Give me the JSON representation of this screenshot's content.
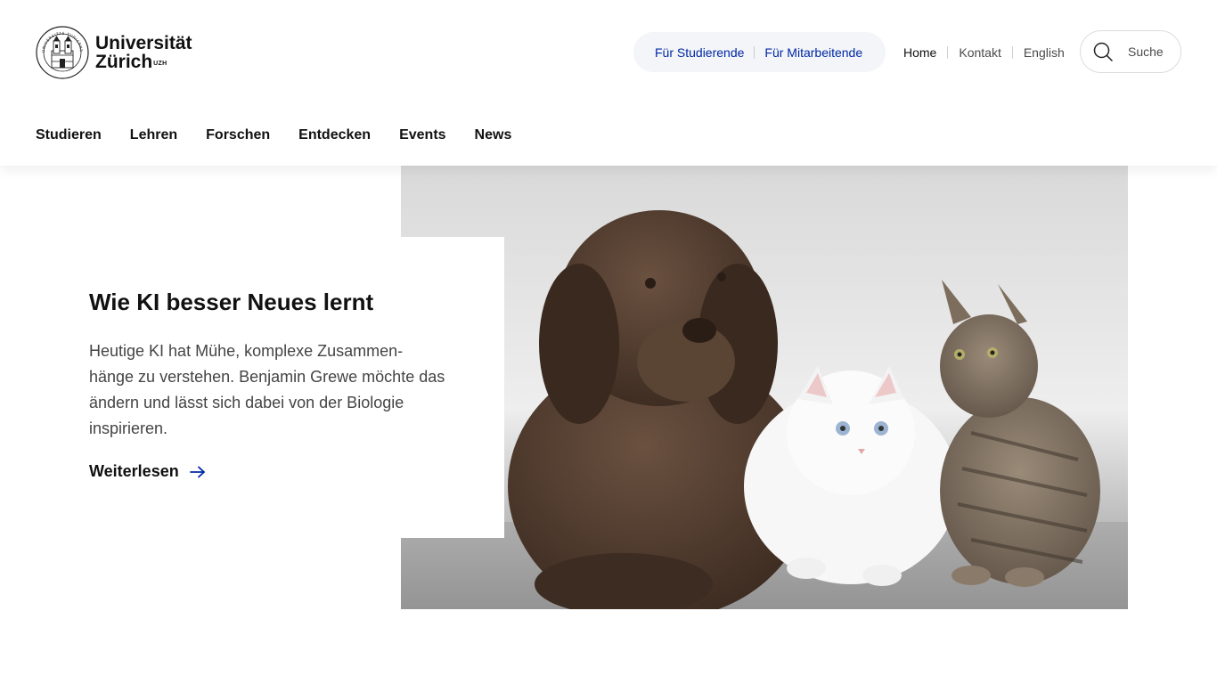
{
  "brand": {
    "line1": "Universität",
    "line2": "Zürich",
    "superscript": "UZH",
    "seal_text": "UNIVERSITAS TURICENSIS MDCCCXXXIII"
  },
  "target_nav": [
    {
      "label": "Für Studierende"
    },
    {
      "label": "Für Mitarbeitende"
    }
  ],
  "meta_nav": [
    {
      "label": "Home",
      "active": true
    },
    {
      "label": "Kontakt",
      "active": false
    },
    {
      "label": "English",
      "active": false
    }
  ],
  "search": {
    "label": "Suche",
    "icon": "search-icon"
  },
  "main_nav": [
    {
      "label": "Studieren"
    },
    {
      "label": "Lehren"
    },
    {
      "label": "Forschen"
    },
    {
      "label": "Entdecken"
    },
    {
      "label": "Events"
    },
    {
      "label": "News"
    }
  ],
  "hero": {
    "title": "Wie KI besser Neues lernt",
    "text": "Heutige KI hat Mühe, komplexe Zusammen-hänge zu verstehen. Benjamin Grewe möchte das ändern und lässt sich dabei von der Biologie inspirieren.",
    "link_label": "Weiterlesen",
    "link_icon": "arrow-right-icon",
    "image_subject": "dog-and-two-cats-photo"
  },
  "colors": {
    "link_blue": "#0028a5",
    "pill_background": "#f3f5f8",
    "text": "#111111"
  }
}
